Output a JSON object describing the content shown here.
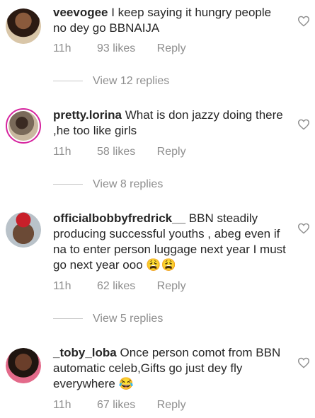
{
  "comments": [
    {
      "username": "veevogee",
      "text": "I keep saying it hungry people no dey go BBNAIJA",
      "time": "11h",
      "likes": "93 likes",
      "reply": "Reply",
      "view_replies": "View 12 replies"
    },
    {
      "username": "pretty.lorina",
      "text": "What is don jazzy doing there ,he too like girls",
      "time": "11h",
      "likes": "58 likes",
      "reply": "Reply",
      "view_replies": "View 8 replies"
    },
    {
      "username": "officialbobbyfredrick__",
      "text": "BBN steadily producing successful youths , abeg even if na to enter person luggage next year I must go next year ooo 😩😩",
      "time": "11h",
      "likes": "62 likes",
      "reply": "Reply",
      "view_replies": "View 5 replies"
    },
    {
      "username": "_toby_loba",
      "text": "Once person comot from BBN automatic celeb,Gifts go just dey fly everywhere 😂",
      "time": "11h",
      "likes": "67 likes",
      "reply": "Reply"
    }
  ],
  "icons": {
    "like": "heart-icon"
  },
  "colors": {
    "secondary_text": "#8e8e8e",
    "primary_text": "#262626",
    "story_ring": "#d6249f"
  }
}
